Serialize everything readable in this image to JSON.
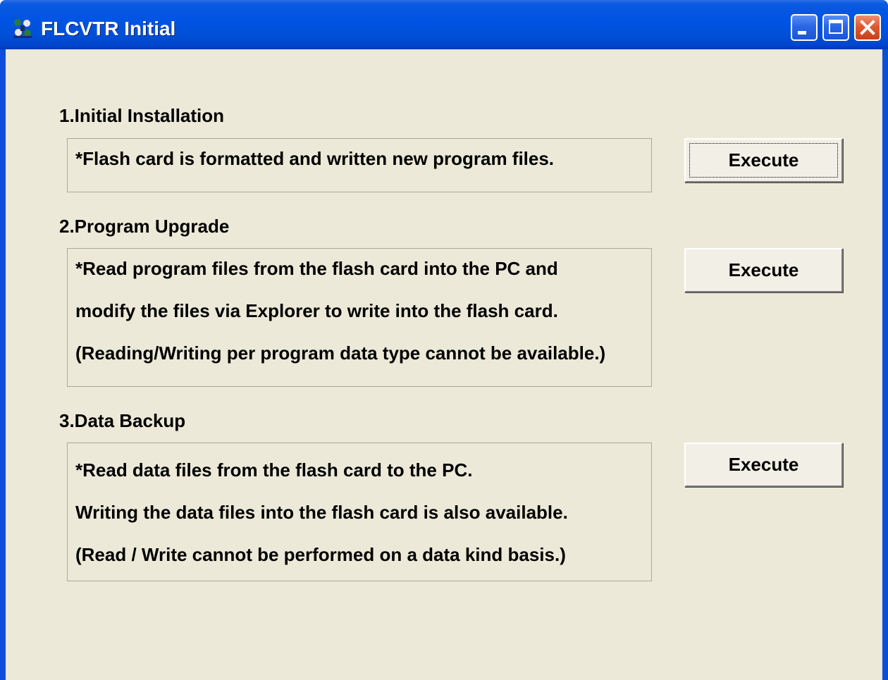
{
  "window": {
    "title": "FLCVTR Initial",
    "icon": "app-icon",
    "controls": [
      "minimize-icon",
      "maximize-icon",
      "close-icon"
    ]
  },
  "sections": [
    {
      "label": "1.Initial Installation",
      "description": [
        "*Flash card is formatted and written new program files."
      ],
      "button_label": "Execute"
    },
    {
      "label": "2.Program Upgrade",
      "description": [
        "*Read program files from the flash card into the PC and",
        "modify the files via Explorer to write into the flash card.",
        "(Reading/Writing per program data type cannot be available.)"
      ],
      "button_label": "Execute"
    },
    {
      "label": "3.Data Backup",
      "description": [
        "*Read data files from the flash card to the PC.",
        "Writing the data files into the flash card is also available.",
        "(Read / Write cannot be performed on a data kind basis.)"
      ],
      "button_label": "Execute"
    }
  ],
  "colors": {
    "titlebar": "#0054e3",
    "client_background": "#ece9d8",
    "close_button": "#e05a30"
  }
}
